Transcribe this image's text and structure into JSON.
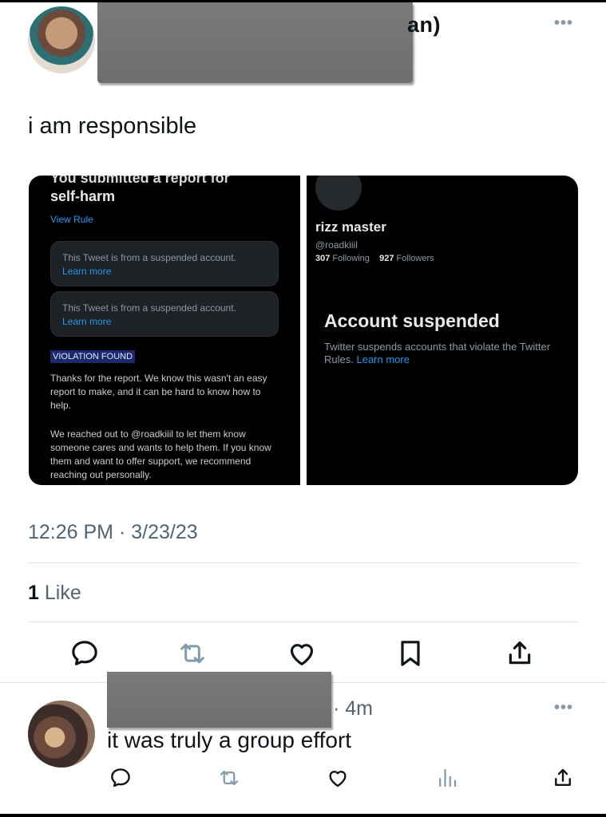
{
  "tweet": {
    "author_name_visible": "an)",
    "text": "i am responsible",
    "timestamp": "12:26 PM · 3/23/23",
    "likes_count": "1",
    "likes_label": "Like"
  },
  "screenshot_left": {
    "top_text": "You submitted a report for",
    "title": "self-harm",
    "view_rule": "View Rule",
    "suspended_text": "This Tweet is from a suspended account.",
    "learn_more": "Learn more",
    "violation_badge": "VIOLATION FOUND",
    "para1": "Thanks for the report. We know this wasn't an easy report to make, and it can be hard to know how to help.",
    "para2": "We reached out to @roadkiiil to let them know someone cares and wants to help them. If you know them and want to offer support, we recommend reaching out personally."
  },
  "screenshot_right": {
    "name": "rizz master",
    "handle": "@roadkiiil",
    "following_count": "307",
    "following_label": "Following",
    "followers_count": "927",
    "followers_label": "Followers",
    "heading": "Account suspended",
    "desc": "Twitter suspends accounts that violate the Twitter Rules.",
    "learn_more": "Learn more"
  },
  "reply": {
    "time": "· 4m",
    "text": "it was truly a group effort"
  },
  "more_glyph": "•••",
  "icons": {
    "actions": [
      "reply-icon",
      "retweet-icon",
      "like-icon",
      "bookmark-icon",
      "share-icon"
    ],
    "reply_actions": [
      "reply-icon",
      "retweet-icon",
      "like-icon",
      "views-icon",
      "share-icon"
    ]
  },
  "colors": {
    "text": "#0f1419",
    "secondary": "#536471",
    "link": "#1d9bf0",
    "card_bg": "#000000"
  }
}
